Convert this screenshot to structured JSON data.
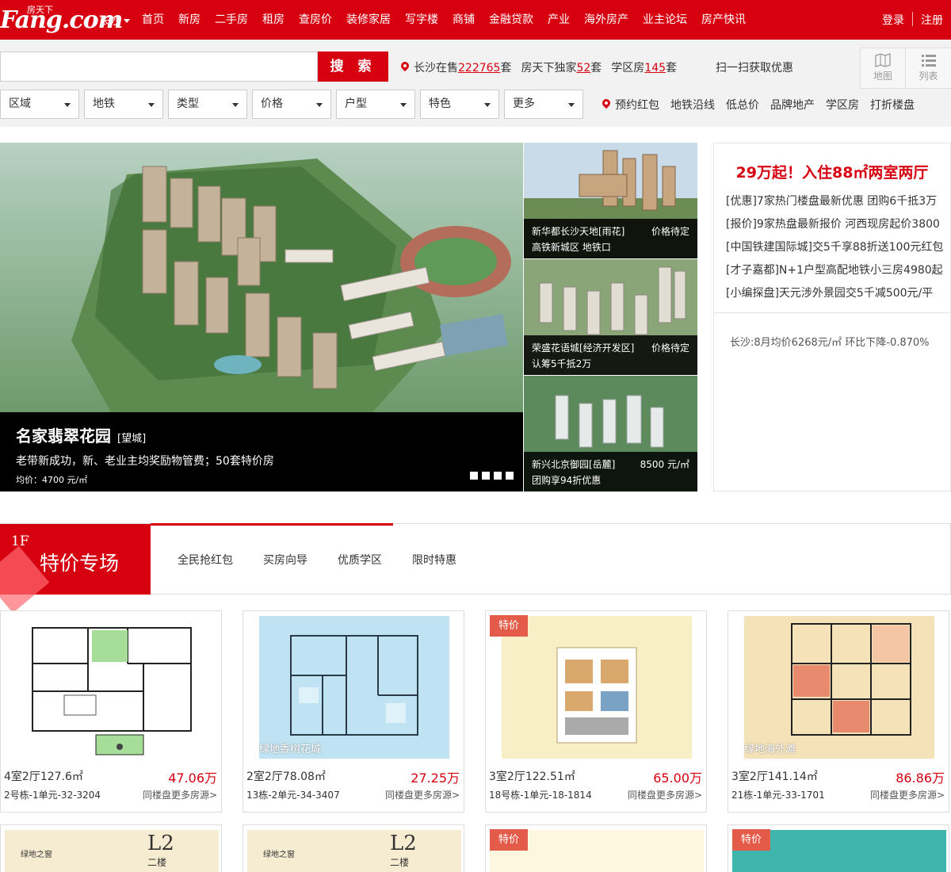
{
  "header": {
    "logo_text": "Fang.com",
    "logo_sub": "房天下",
    "city": "长沙",
    "nav": [
      "首页",
      "新房",
      "二手房",
      "租房",
      "查房价",
      "装修家居",
      "写字楼",
      "商铺",
      "金融贷款",
      "产业",
      "海外房产",
      "业主论坛",
      "房产快讯"
    ],
    "login": "登录",
    "register": "注册"
  },
  "search": {
    "placeholder": "",
    "button": "搜 索",
    "stats": [
      {
        "pre": "长沙在售",
        "num": "222765",
        "post": "套"
      },
      {
        "pre": "房天下独家",
        "num": "52",
        "post": "套"
      },
      {
        "pre": "学区房",
        "num": "145",
        "post": "套"
      }
    ],
    "scan": "扫一扫获取优惠",
    "view_map": "地图",
    "view_list": "列表",
    "filters": [
      "区域",
      "地铁",
      "类型",
      "价格",
      "户型",
      "特色",
      "更多"
    ],
    "quick_links": [
      "预约红包",
      "地铁沿线",
      "低总价",
      "品牌地产",
      "学区房",
      "打折楼盘"
    ]
  },
  "hero": {
    "title": "名家翡翠花园",
    "district": "[望城]",
    "desc": "老带新成功，新、老业主均奖励物管费；50套特价房",
    "price": "均价：4700 元/㎡"
  },
  "thumbs": [
    {
      "line1": "新华都长沙天地[雨花]",
      "price": "价格待定",
      "line2": "高铁新城区 地铁口"
    },
    {
      "line1": "荣盛花语城[经济开发区]",
      "price": "价格待定",
      "line2": "认筹5千抵2万"
    },
    {
      "line1": "新兴北京御园[岳麓]",
      "price": "8500 元/㎡",
      "line2": "团购享94折优惠"
    }
  ],
  "promo": {
    "headline": "29万起！入住88㎡两室两厅",
    "items": [
      "[优惠]7家热门楼盘最新优惠 团购6千抵3万",
      "[报价]9家热盘最新报价 河西现房起价3800",
      "[中国铁建国际城]交5千享88折送100元红包",
      "[才子嘉都]N+1户型高配地铁小三房4980起",
      "[小编探盘]天元涉外景园交5千减500元/平"
    ],
    "avg": "长沙:8月均价6268元/㎡ 环比下降-0.870%"
  },
  "floor": {
    "num": "1F",
    "title": "特价专场",
    "tabs": [
      "全民抢红包",
      "买房向导",
      "优质学区",
      "限时特惠"
    ]
  },
  "cards": [
    {
      "tag": "",
      "title": "4室2厅127.6㎡",
      "price": "47.06万",
      "addr": "2号栋-1单元-32-3204",
      "more": "同楼盘更多房源>",
      "watermark": "",
      "bg": "#ffffff"
    },
    {
      "tag": "",
      "title": "2室2厅78.08㎡",
      "price": "27.25万",
      "addr": "13栋-2单元-34-3407",
      "more": "同楼盘更多房源>",
      "watermark": "绿地香树花城",
      "bg": "#bfe3f3"
    },
    {
      "tag": "特价",
      "title": "3室2厅122.51㎡",
      "price": "65.00万",
      "addr": "18号栋-1单元-18-1814",
      "more": "同楼盘更多房源>",
      "watermark": "",
      "bg": "#f8efc7"
    },
    {
      "tag": "",
      "title": "3室2厅141.14㎡",
      "price": "86.86万",
      "addr": "21栋-1单元-33-1701",
      "more": "同楼盘更多房源>",
      "watermark": "绿地海外滩",
      "bg": "#f6e2b8"
    }
  ],
  "cards_row2": [
    {
      "tag": "",
      "brand": "绿地之窗",
      "label": "L2",
      "sub": "二楼",
      "bg": "#f6ecd2"
    },
    {
      "tag": "",
      "brand": "绿地之窗",
      "label": "L2",
      "sub": "二楼",
      "bg": "#f6ecd2"
    },
    {
      "tag": "特价",
      "brand": "",
      "label": "",
      "sub": "",
      "bg": "#fdf7e0"
    },
    {
      "tag": "特价",
      "brand": "",
      "label": "",
      "sub": "",
      "bg": "#3fb6ad"
    }
  ]
}
